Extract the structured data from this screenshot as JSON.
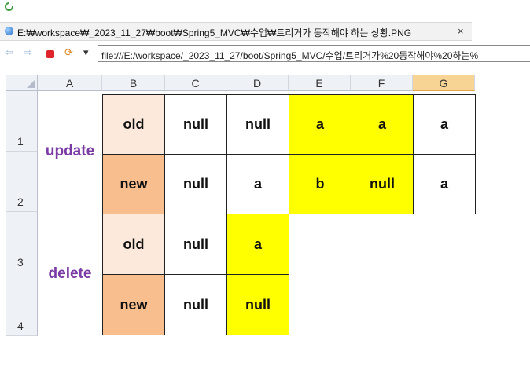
{
  "window": {
    "tab_title": "E:₩workspace₩_2023_11_27₩boot₩Spring5_MVC₩수업₩트리거가 동작해야 하는 상황.PNG",
    "tab_close": "×",
    "url": "file:///E:/workspace/_2023_11_27/boot/Spring5_MVC/수업/트리거가%20동작해야%20하는%"
  },
  "toolbar": {
    "back": "⇦",
    "forward": "⇨",
    "refresh": "⟳",
    "dropdown": "▾"
  },
  "sheet": {
    "columns": [
      "A",
      "B",
      "C",
      "D",
      "E",
      "F",
      "G"
    ],
    "selected_column": "G",
    "rows": [
      "1",
      "2",
      "3",
      "4"
    ],
    "labels": {
      "update": "update",
      "delete": "delete"
    },
    "r1": [
      "old",
      "null",
      "null",
      "a",
      "a",
      "a"
    ],
    "r2": [
      "new",
      "null",
      "a",
      "b",
      "null",
      "a"
    ],
    "r3": [
      "old",
      "null",
      "a"
    ],
    "r4": [
      "new",
      "null",
      "null"
    ]
  },
  "colors": {
    "old_fill": "#fde9dc",
    "new_fill": "#f9be8e",
    "yellow": "#ffff00",
    "label_color": "#7a3ba5",
    "selected_header": "#f8d494"
  }
}
